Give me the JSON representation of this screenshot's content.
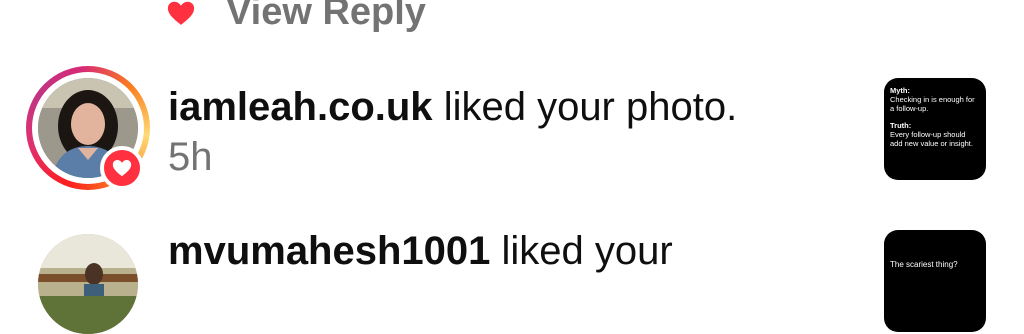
{
  "previous": {
    "view_reply": "View Reply"
  },
  "notifications": [
    {
      "username": "iamleah.co.uk",
      "action": "liked your photo.",
      "time": "5h",
      "thumbnail": {
        "myth_label": "Myth:",
        "myth_text": "Checking in is enough for a follow-up.",
        "truth_label": "Truth:",
        "truth_text": "Every follow-up should add new value or insight."
      }
    },
    {
      "username": "mvumahesh1001",
      "action": "liked your",
      "thumbnail": {
        "text": "The scariest thing?"
      }
    }
  ],
  "colors": {
    "like_red": "#ff3040",
    "muted_text": "#737373",
    "text": "#0f0f0f"
  }
}
